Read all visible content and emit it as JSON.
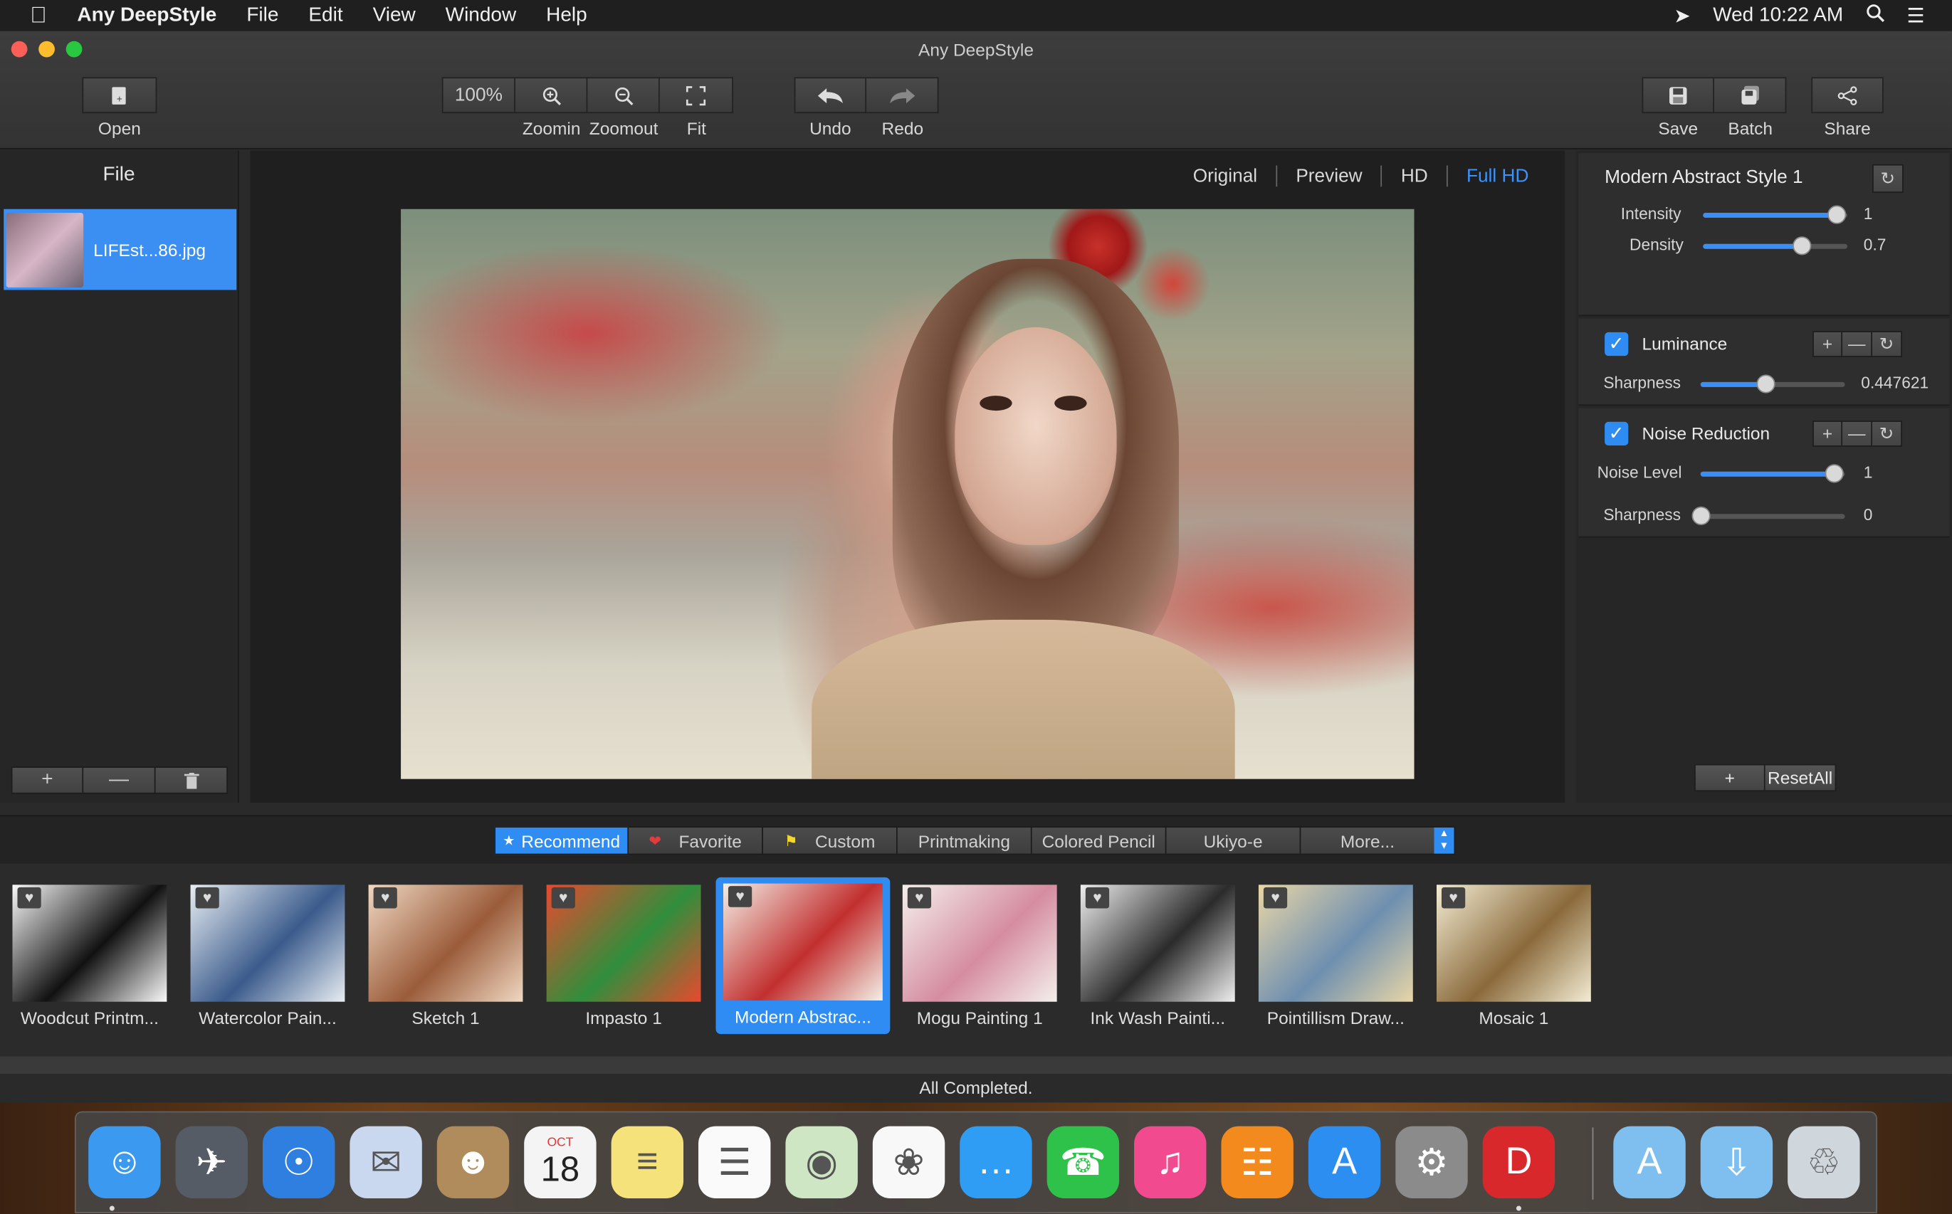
{
  "menubar": {
    "app_name": "Any DeepStyle",
    "items": [
      "File",
      "Edit",
      "View",
      "Window",
      "Help"
    ],
    "clock": "Wed 10:22 AM"
  },
  "window": {
    "title": "Any DeepStyle"
  },
  "toolbar": {
    "open_label": "Open",
    "zoom_value": "100%",
    "zoomin_label": "Zoomin",
    "zoomout_label": "Zoomout",
    "fit_label": "Fit",
    "undo_label": "Undo",
    "redo_label": "Redo",
    "save_label": "Save",
    "batch_label": "Batch",
    "share_label": "Share"
  },
  "file_panel": {
    "heading": "File",
    "files": [
      {
        "name": "LIFEst...86.jpg"
      }
    ]
  },
  "view_modes": {
    "items": [
      "Original",
      "Preview",
      "HD",
      "Full HD"
    ],
    "active": "Full HD"
  },
  "style_settings": {
    "style_name": "Modern Abstract Style 1",
    "intensity_label": "Intensity",
    "intensity_value": "1",
    "intensity_level": 0.92,
    "density_label": "Density",
    "density_value": "0.7",
    "density_level": 0.68
  },
  "luminance": {
    "label": "Luminance",
    "checked": true,
    "sharpness_label": "Sharpness",
    "sharpness_value": "0.447621",
    "sharpness_level": 0.45
  },
  "noise_reduction": {
    "label": "Noise Reduction",
    "checked": true,
    "noise_level_label": "Noise Level",
    "noise_level_value": "1",
    "noise_level_level": 0.92,
    "sharpness_label": "Sharpness",
    "sharpness_value": "0",
    "sharpness_level": 0.0
  },
  "right_footer": {
    "add_label": "+",
    "reset_label": "ResetAll"
  },
  "style_tabs": {
    "items": [
      "Recommend",
      "Favorite",
      "Custom",
      "Printmaking",
      "Colored Pencil",
      "Ukiyo-e",
      "More..."
    ],
    "active": "Recommend"
  },
  "styles": [
    {
      "label": "Woodcut Printm...",
      "colors": [
        "#fafafa",
        "#111111"
      ]
    },
    {
      "label": "Watercolor Pain...",
      "colors": [
        "#e8eef2",
        "#3b5b8c"
      ]
    },
    {
      "label": "Sketch 1",
      "colors": [
        "#f0d8c2",
        "#9a5c3a"
      ]
    },
    {
      "label": "Impasto 1",
      "colors": [
        "#e8492f",
        "#2f8f3c"
      ]
    },
    {
      "label": "Modern Abstrac...",
      "colors": [
        "#f3efe6",
        "#c22f2f"
      ]
    },
    {
      "label": "Mogu Painting 1",
      "colors": [
        "#f4f0ec",
        "#d58ca1"
      ]
    },
    {
      "label": "Ink Wash Painti...",
      "colors": [
        "#efefef",
        "#2b2b2b"
      ]
    },
    {
      "label": "Pointillism Draw...",
      "colors": [
        "#e9d6a7",
        "#6e8fb0"
      ]
    },
    {
      "label": "Mosaic 1",
      "colors": [
        "#f3ecd3",
        "#8a6a3c"
      ]
    }
  ],
  "status": {
    "text": "All Completed."
  },
  "dock": {
    "icons": [
      "finder-icon",
      "launchpad-icon",
      "safari-icon",
      "mail-icon",
      "contacts-icon",
      "calendar-icon",
      "notes-icon",
      "reminders-icon",
      "maps-icon",
      "photos-icon",
      "messages-icon",
      "facetime-icon",
      "itunes-icon",
      "ibooks-icon",
      "app-store-icon",
      "system-preferences-icon",
      "any-deepstyle-icon",
      "applications-folder-icon",
      "downloads-folder-icon",
      "trash-icon"
    ],
    "calendar_month": "OCT",
    "calendar_day": "18"
  },
  "colors": {
    "accent": "#2f8cf3",
    "panel": "#262626",
    "toolbar": "#3a3a3a"
  }
}
